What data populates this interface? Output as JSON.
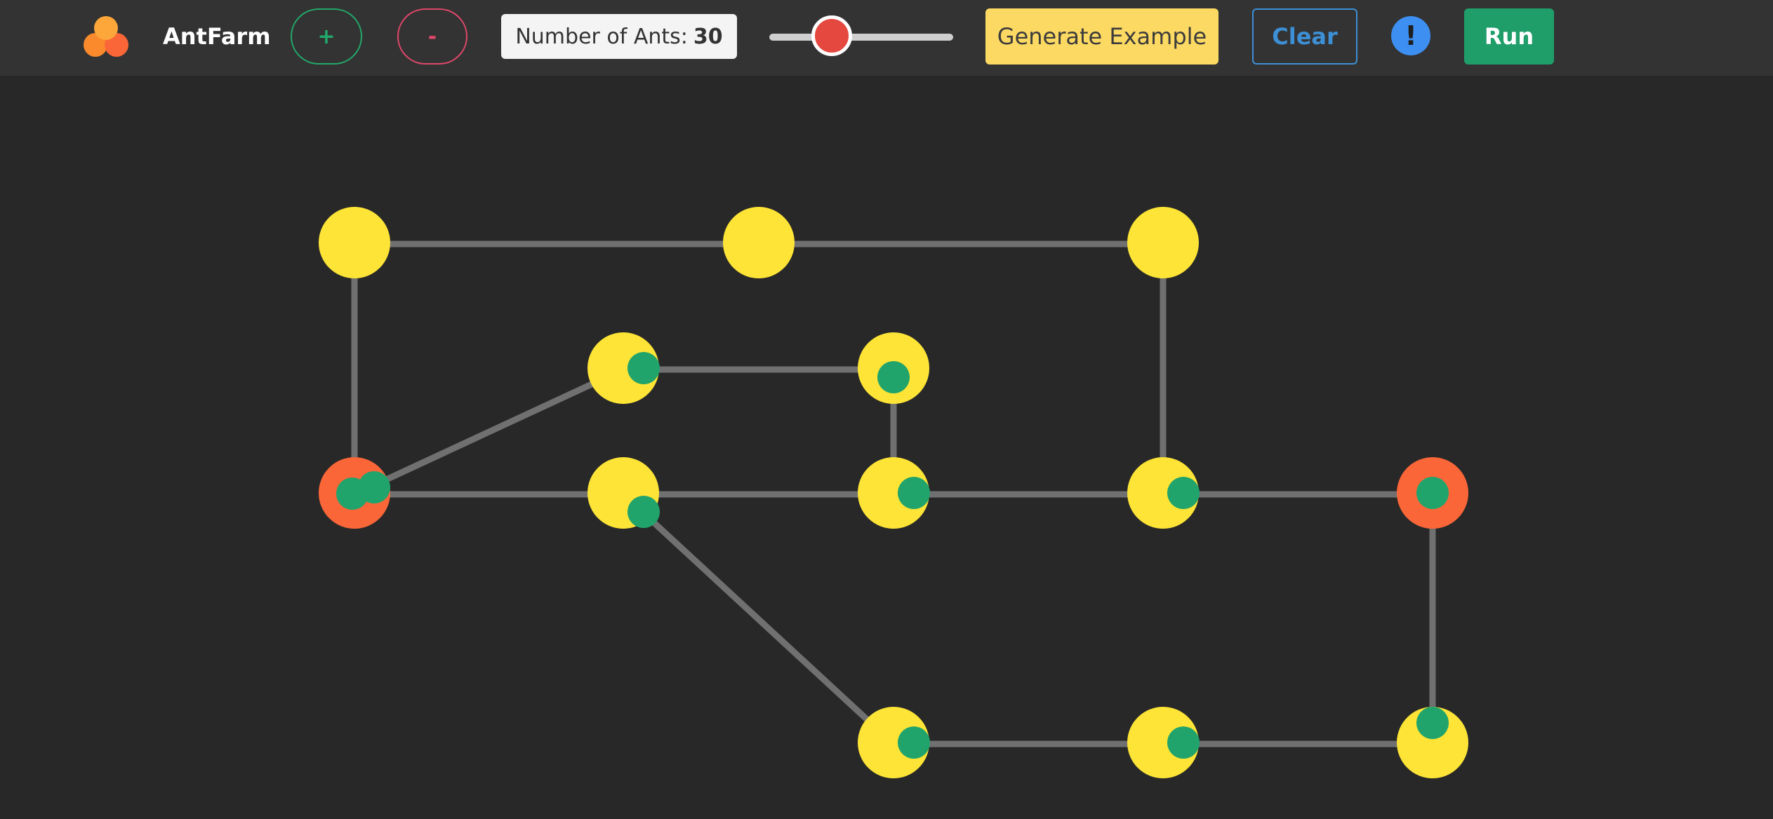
{
  "header": {
    "app_title": "AntFarm",
    "add_label": "+",
    "remove_label": "-",
    "ant_count_label": "Number of Ants:",
    "ant_count_value": "30",
    "slider_value_fraction": 0.34,
    "generate_label": "Generate Example",
    "clear_label": "Clear",
    "info_label": "!",
    "run_label": "Run"
  },
  "colors": {
    "background": "#282828",
    "toolbar": "#333333",
    "room": "#fde436",
    "endpoint_room": "#fa6638",
    "ant": "#21a46c",
    "tunnel": "#707070",
    "add": "#22a86a",
    "remove": "#e0476a",
    "generate": "#fcd962",
    "clear": "#3d8fd6",
    "info": "#3d8ff2",
    "run": "#1f9e6a",
    "slider_thumb": "#e5483f"
  },
  "graph": {
    "rooms": [
      {
        "id": "r1",
        "type": "room"
      },
      {
        "id": "r2",
        "type": "room"
      },
      {
        "id": "r3",
        "type": "room"
      },
      {
        "id": "r4",
        "type": "room"
      },
      {
        "id": "r5",
        "type": "room"
      },
      {
        "id": "r6",
        "type": "start"
      },
      {
        "id": "r7",
        "type": "room"
      },
      {
        "id": "r8",
        "type": "room"
      },
      {
        "id": "r9",
        "type": "room"
      },
      {
        "id": "r10",
        "type": "end"
      },
      {
        "id": "r11",
        "type": "room"
      },
      {
        "id": "r12",
        "type": "room"
      },
      {
        "id": "r13",
        "type": "room"
      }
    ],
    "tunnels": [
      [
        "r1",
        "r2"
      ],
      [
        "r2",
        "r3"
      ],
      [
        "r1",
        "r6"
      ],
      [
        "r3",
        "r9"
      ],
      [
        "r4",
        "r5"
      ],
      [
        "r5",
        "r8"
      ],
      [
        "r6",
        "r4"
      ],
      [
        "r6",
        "r7"
      ],
      [
        "r7",
        "r8"
      ],
      [
        "r8",
        "r9"
      ],
      [
        "r9",
        "r10"
      ],
      [
        "r10",
        "r13"
      ],
      [
        "r7",
        "r11"
      ],
      [
        "r11",
        "r12"
      ],
      [
        "r12",
        "r13"
      ]
    ],
    "ants": [
      {
        "room": "r4"
      },
      {
        "room": "r5"
      },
      {
        "room": "r6"
      },
      {
        "room": "r6"
      },
      {
        "room": "r7"
      },
      {
        "room": "r8"
      },
      {
        "room": "r9"
      },
      {
        "room": "r10"
      },
      {
        "room": "r11"
      },
      {
        "room": "r12"
      },
      {
        "room": "r13"
      }
    ]
  }
}
